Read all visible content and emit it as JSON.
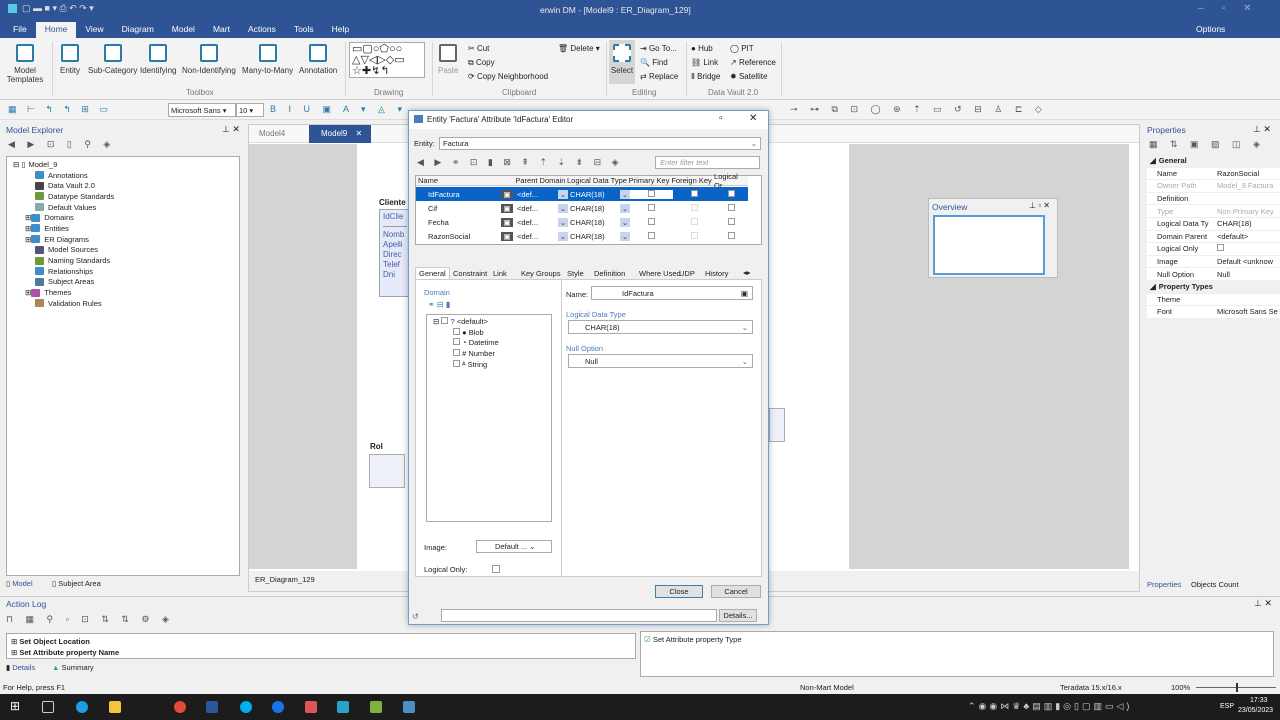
{
  "window": {
    "title": "erwin DM - [Model9 : ER_Diagram_129]",
    "options": "Options"
  },
  "menu": [
    "File",
    "Home",
    "View",
    "Diagram",
    "Model",
    "Mart",
    "Actions",
    "Tools",
    "Help"
  ],
  "ribbon": {
    "toolbox": [
      "Entity",
      "Sub-Category",
      "Identifying",
      "Non-Identifying",
      "Many-to-Many",
      "Annotation"
    ],
    "model_templates": "Model Templates",
    "groups": {
      "toolbox": "Toolbox",
      "drawing": "Drawing",
      "clipboard": "Clipboard",
      "editing": "Editing",
      "datavault": "Data Vault 2.0"
    },
    "clipboard": {
      "paste": "Paste",
      "cut": "Cut",
      "copy": "Copy",
      "copy_neighborhood": "Copy Neighborhood",
      "delete": "Delete"
    },
    "editing": {
      "select": "Select",
      "goto": "Go To...",
      "find": "Find",
      "replace": "Replace"
    },
    "datavault": {
      "hub": "Hub",
      "link": "Link",
      "bridge": "Bridge",
      "pit": "PIT",
      "reference": "Reference",
      "satellite": "Satellite"
    }
  },
  "format": {
    "font": "Microsoft Sans",
    "size": "10"
  },
  "explorer": {
    "title": "Model Explorer",
    "root": "Model_9",
    "items": [
      "Annotations",
      "Data Vault 2.0",
      "Datatype Standards",
      "Default Values",
      "Domains",
      "Entities",
      "ER Diagrams",
      "Model Sources",
      "Naming Standards",
      "Relationships",
      "Subject Areas",
      "Themes",
      "Validation Rules"
    ],
    "tabs": [
      "Model",
      "Subject Area"
    ]
  },
  "doc_tabs": [
    "Model4",
    "Model9"
  ],
  "diagram": {
    "entity1": {
      "name": "Cliente",
      "key": "IdClie",
      "attrs": [
        "Nomb",
        "Apelli",
        "Direc",
        "Telef",
        "Dni"
      ]
    },
    "entity2": {
      "name": "Rol"
    },
    "tab": "ER_Diagram_129"
  },
  "overview": {
    "title": "Overview"
  },
  "dialog": {
    "title": "Entity 'Factura' Attribute 'IdFactura' Editor",
    "entity_label": "Entity:",
    "entity": "Factura",
    "filter_placeholder": "Enter filter text",
    "columns": [
      "Name",
      "Parent Domain",
      "Logical Data Type",
      "Primary Key",
      "Foreign Key",
      "Logical Or"
    ],
    "rows": [
      {
        "name": "IdFactura",
        "domain": "<def...",
        "type": "CHAR(18)"
      },
      {
        "name": "Cif",
        "domain": "<def...",
        "type": "CHAR(18)"
      },
      {
        "name": "Fecha",
        "domain": "<def...",
        "type": "CHAR(18)"
      },
      {
        "name": "RazonSocial",
        "domain": "<def...",
        "type": "CHAR(18)"
      }
    ],
    "tabs": [
      "General",
      "Constraint",
      "Link",
      "Key Groups",
      "Style",
      "Definition",
      "Where Used",
      "UDP",
      "History"
    ],
    "domain_label": "Domain",
    "domains": [
      "<default>",
      "Blob",
      "Datetime",
      "Number",
      "String"
    ],
    "name_label": "Name:",
    "name": "IdFactura",
    "ldt_label": "Logical Data Type",
    "ldt": "CHAR(18)",
    "null_label": "Null Option",
    "null": "Null",
    "image_label": "Image:",
    "image": "Default ...",
    "logical_only_label": "Logical Only:",
    "close": "Close",
    "cancel": "Cancel",
    "details": "Details..."
  },
  "properties": {
    "title": "Properties",
    "general": "General",
    "rows": [
      {
        "k": "Name",
        "v": "RazonSocial"
      },
      {
        "k": "Owner Path",
        "v": "Model_9.Factura",
        "dim": true
      },
      {
        "k": "Definition",
        "v": ""
      },
      {
        "k": "Type",
        "v": "Non Primary Key",
        "dim": true
      },
      {
        "k": "Logical Data Ty",
        "v": "CHAR(18)"
      },
      {
        "k": "Domain Parent",
        "v": "<default>"
      },
      {
        "k": "Logical Only",
        "v": ""
      },
      {
        "k": "Image",
        "v": "Default <unknow"
      },
      {
        "k": "Null Option",
        "v": "Null"
      }
    ],
    "types": "Property Types",
    "type_rows": [
      {
        "k": "Theme",
        "v": ""
      },
      {
        "k": "Font",
        "v": "Microsoft Sans Se"
      }
    ],
    "tabs": [
      "Properties",
      "Objects Count"
    ]
  },
  "action_log": {
    "title": "Action Log",
    "items": [
      "Set Object Location",
      "Set Attribute property Name"
    ],
    "tabs": [
      "Details",
      "Summary"
    ],
    "right_item": "Set Attribute property Type"
  },
  "status": {
    "help": "For Help, press F1",
    "mart": "Non-Mart Model",
    "db": "Teradata 15.x/16.x",
    "zoom": "100%"
  },
  "taskbar": {
    "time": "17:33",
    "date": "23/05/2023",
    "lang": "ESP"
  }
}
